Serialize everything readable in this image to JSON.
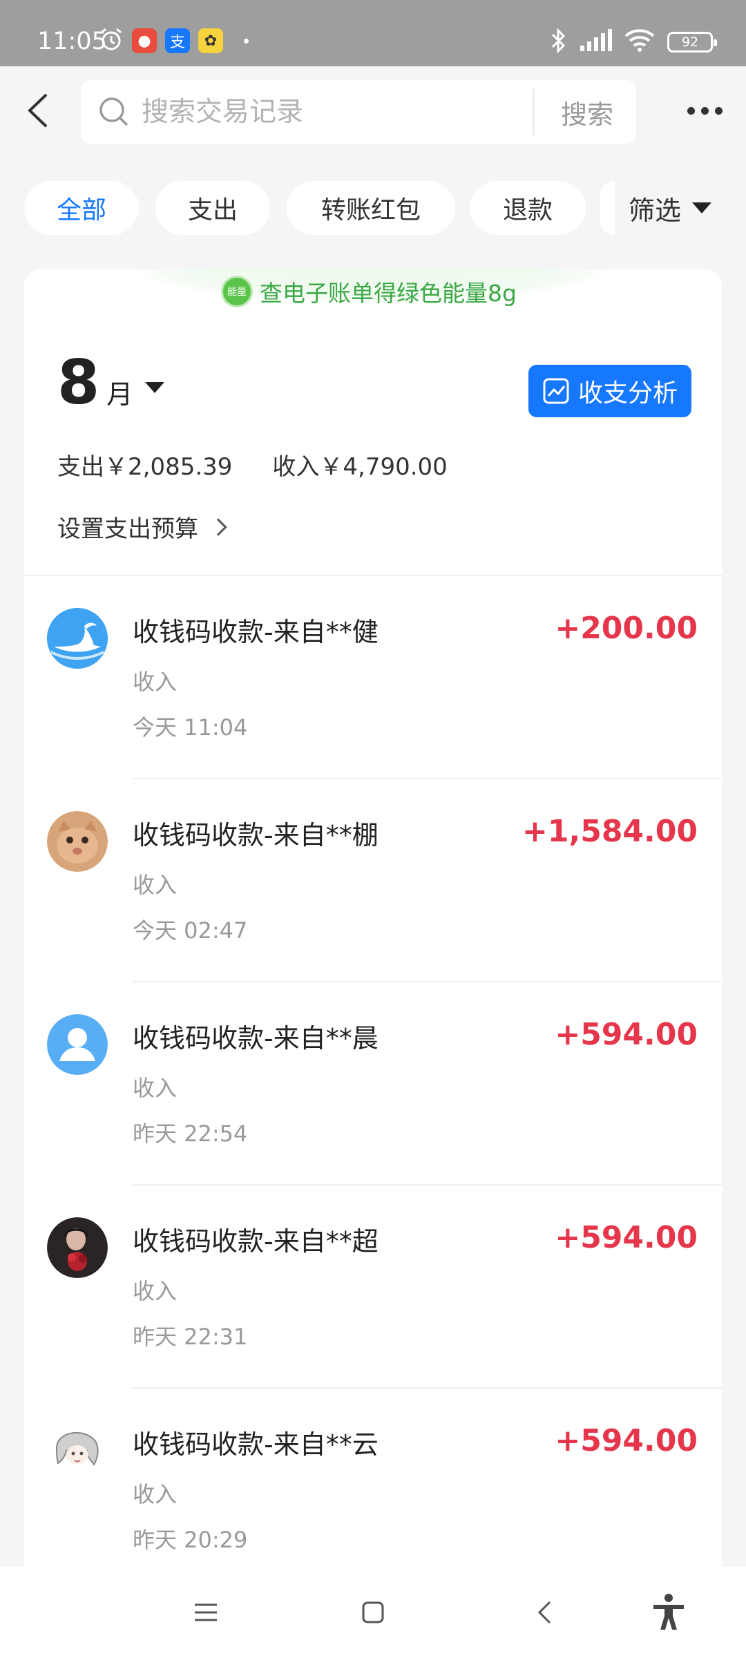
{
  "status_bar": {
    "time": "11:05",
    "battery": "92",
    "app_icons": [
      "alarm-icon",
      "app-icon-red",
      "alipay-icon",
      "app-icon-yellow"
    ]
  },
  "header": {
    "search_placeholder": "搜索交易记录",
    "search_button": "搜索"
  },
  "filters": {
    "chips": [
      "全部",
      "支出",
      "转账红包",
      "退款"
    ],
    "active": "全部",
    "filter_label": "筛选"
  },
  "promo": {
    "badge": "能量",
    "text": "查电子账单得绿色能量8g"
  },
  "month": {
    "number": "8",
    "unit": "月"
  },
  "analysis_button": "收支分析",
  "summary": {
    "expense": "支出￥2,085.39",
    "income": "收入￥4,790.00"
  },
  "budget_label": "设置支出预算",
  "transactions": [
    {
      "title": "收钱码收款-来自**健",
      "type": "收入",
      "time": "今天 11:04",
      "amount": "+200.00",
      "avatar": "whale-avatar"
    },
    {
      "title": "收钱码收款-来自**棚",
      "type": "收入",
      "time": "今天 02:47",
      "amount": "+1,584.00",
      "avatar": "cat-avatar"
    },
    {
      "title": "收钱码收款-来自**晨",
      "type": "收入",
      "time": "昨天 22:54",
      "amount": "+594.00",
      "avatar": "default-user-avatar"
    },
    {
      "title": "收钱码收款-来自**超",
      "type": "收入",
      "time": "昨天 22:31",
      "amount": "+594.00",
      "avatar": "photo-avatar"
    },
    {
      "title": "收钱码收款-来自**云",
      "type": "收入",
      "time": "昨天 20:29",
      "amount": "+594.00",
      "avatar": "anime-avatar"
    }
  ],
  "colors": {
    "accent": "#1677ff",
    "income": "#e5364b",
    "promo_green": "#3aa845"
  }
}
